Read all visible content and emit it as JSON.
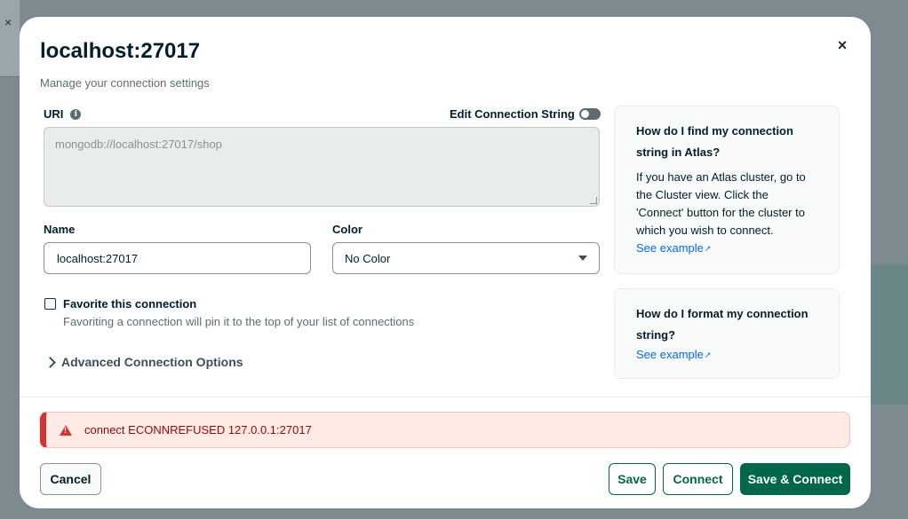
{
  "backdrop": {
    "close_glyph": "×"
  },
  "modal": {
    "title": "localhost:27017",
    "subtitle": "Manage your connection settings",
    "close_glyph": "×"
  },
  "uri": {
    "label": "URI",
    "info_glyph": "i",
    "edit_toggle_label": "Edit Connection String",
    "edit_toggle_on": false,
    "value": "mongodb://localhost:27017/shop"
  },
  "name": {
    "label": "Name",
    "value": "localhost:27017"
  },
  "color": {
    "label": "Color",
    "value": "No Color"
  },
  "favorite": {
    "label": "Favorite this connection",
    "description": "Favoriting a connection will pin it to the top of your list of connections",
    "checked": false
  },
  "advanced": {
    "label": "Advanced Connection Options"
  },
  "help": [
    {
      "title": "How do I find my connection string in Atlas?",
      "body": "If you have an Atlas cluster, go to the Cluster view. Click the 'Connect' button for the cluster to which you wish to connect.",
      "link": "See example"
    },
    {
      "title": "How do I format my connection string?",
      "link": "See example"
    }
  ],
  "error": {
    "message": "connect ECONNREFUSED 127.0.0.1:27017"
  },
  "buttons": {
    "cancel": "Cancel",
    "save": "Save",
    "connect": "Connect",
    "save_connect": "Save & Connect"
  },
  "colors": {
    "accent_green": "#00684a",
    "error_red": "#db3030",
    "link_blue": "#016bf8"
  },
  "icons": [
    "close-icon",
    "info-icon",
    "toggle-switch",
    "chevron-down-icon",
    "chevron-right-icon",
    "external-link-icon",
    "warning-icon"
  ]
}
